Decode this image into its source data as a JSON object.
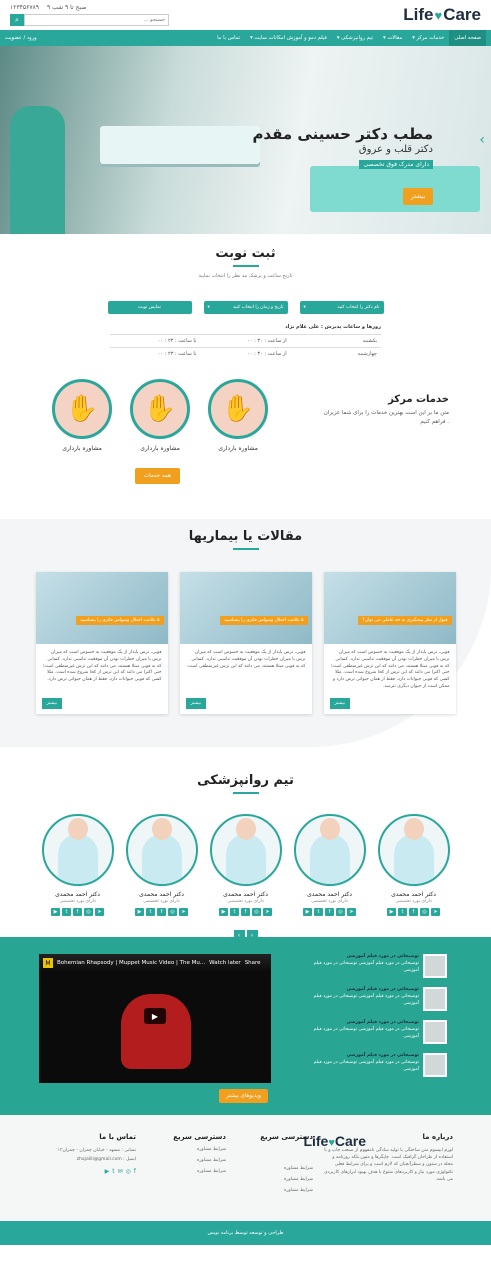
{
  "brand": {
    "logo_left": "Life",
    "logo_right": "Care",
    "logo_heart": "♥"
  },
  "topbar": {
    "phone": "۱۲۳۴۵۶۷۸۹",
    "hours": "۹ صبح تا ۹ شب",
    "search_placeholder": "جستجو ...",
    "search_icon": "search-icon"
  },
  "nav": {
    "items": [
      "صفحه اصلی",
      "خدمات مرکز ▾",
      "مقالات ▾",
      "تیم روانپزشکی ▾",
      "فیلم دمو و آموزش امکانات سایت ▾",
      "تماس با ما"
    ],
    "login": "ورود / عضویت"
  },
  "hero": {
    "title": "مطب دکتر حسینی مقدم",
    "subtitle": "دکتر قلب و عروق",
    "tag": "دارای مدرک فوق تخصصی",
    "button": "بیشتر",
    "arrow": "‹"
  },
  "booking": {
    "title": "ثبت نوبت",
    "desc": "تاریخ ساعت و پزشک مد نظر را انتخاب نمایید",
    "select_doctor": "نام دکتر را انتخاب کنید",
    "select_time": "تاریخ و زمان را انتخاب کنید",
    "show": "نمایش نوبت",
    "schedule_label": "روزها و ساعات پذیرش : علی غلام نژاد",
    "rows": [
      [
        "یکشنبه",
        "از ساعت : ۳۰ : ۰۰",
        "تا ساعت : ۲۳ : ۰۰"
      ],
      [
        "چهارشنبه",
        "از ساعت : ۳۰ : ۰۰",
        "تا ساعت : ۲۳ : ۰۰"
      ]
    ]
  },
  "services": {
    "title": "خدمات مرکز",
    "desc": "متن ما بر این است بهترین خدمات را برای شما عزیزان فراهم کنیم .",
    "items": [
      "مشاوره بارداری",
      "مشاوره بارداری",
      "مشاوره بارداری"
    ],
    "all": "همه خدمات"
  },
  "articles": {
    "title": "مقالات یا بیماریها",
    "cards": [
      {
        "ribbon": "قبول از نظر پیشگیری به جه عاملی می توان؟",
        "text": "فوبی، ترس پایدار از یک موقعیت به خصوص است که میزان ترس با میزان خطرات بودن آن موقعیت تناسبی ندارد. کسانی که به فوبی مبتلا هستند، می دانند که این ترس غیرمنطقی است؛ حتی اکثرا می دانند که این ترس از کجا شروع شده است. مثلا کسی که فوبی حیوانات دارد، فقط از همان حیوانی ترس دارد و ممکن است از حیوان دیگری نترسد.",
        "btn": "بیشتر"
      },
      {
        "ribbon": "۵ علامت اختلال وسواس فکری را بشناسید",
        "text": "فوبی، ترس پایدار از یک موقعیت به خصوص است که میزان ترس با میزان خطرات بودن آن موقعیت تناسبی ندارد. کسانی که به فوبی مبتلا هستند، می دانند که این ترس غیرمنطقی است.",
        "btn": "بیشتر"
      },
      {
        "ribbon": "۵ علامت اختلال وسواس فکری را بشناسید",
        "text": "فوبی، ترس پایدار از یک موقعیت به خصوص است که میزان ترس با میزان خطرات بودن آن موقعیت تناسبی ندارد. کسانی که به فوبی مبتلا هستند، می دانند که این ترس غیرمنطقی است؛ حتی اکثرا می دانند که این ترس از کجا شروع شده است. مثلا کسی که فوبی حیوانات دارد، فقط از همان حیوانی ترس دارد.",
        "btn": "بیشتر"
      }
    ]
  },
  "team": {
    "title": "تیم روانپزشکی",
    "doctors": [
      {
        "name": "دکتر احمد محمدی",
        "role": "دارای بورد تخصصی"
      },
      {
        "name": "دکتر احمد محمدی",
        "role": "دارای بورد تخصصی"
      },
      {
        "name": "دکتر احمد محمدی",
        "role": "دارای بورد تخصصی"
      },
      {
        "name": "دکتر احمد محمدی",
        "role": "دارای بورد تخصصی"
      },
      {
        "name": "دکتر احمد محمدی",
        "role": "دارای بورد تخصصی"
      }
    ],
    "prev": "‹",
    "next": "›"
  },
  "video": {
    "title": "Bohemian Rhapsody | Muppet Music Video | The Mu...",
    "watch_later": "Watch later",
    "share": "Share",
    "all": "ویدیوهای بیشتر",
    "items": [
      {
        "t": "توضیحاتی در مورد فیلم آموزشی",
        "d": "توضیحاتی در مورد فیلم آموزشی توضیحاتی در مورد فیلم آموزشی"
      },
      {
        "t": "توضیحاتی در مورد فیلم آموزشی",
        "d": "توضیحاتی در مورد فیلم آموزشی توضیحاتی در مورد فیلم آموزشی"
      },
      {
        "t": "توضیحاتی در مورد فیلم آموزشی",
        "d": "توضیحاتی در مورد فیلم آموزشی توضیحاتی در مورد فیلم آموزشی"
      },
      {
        "t": "توضیحاتی در مورد فیلم آموزشی",
        "d": "توضیحاتی در مورد فیلم آموزشی توضیحاتی در مورد فیلم آموزشی"
      }
    ]
  },
  "footer": {
    "about_title": "درباره ما",
    "about_text": "لورم ایپسوم متن ساختگی با تولید سادگی نامفهوم از صنعت چاپ و با استفاده از طراحان گرافیک است. چاپگرها و متون بلکه روزنامه و مجله در ستون و سطرآنچنان که لازم است و برای شرایط فعلی تکنولوژی مورد نیاز و کاربردهای متنوع با هدف بهبود ابزارهای کاربردی می باشد.",
    "quick_title": "دسترسی سریع",
    "quick": [
      "شرایط مشاوره",
      "شرایط مشاوره",
      "شرایط مشاوره"
    ],
    "quick2_title": "دسترسی سریع",
    "quick2": [
      "شرایط مشاوره",
      "شرایط مشاوره",
      "شرایط مشاوره"
    ],
    "contact_title": "تماس با ما",
    "address": "نشانی : مشهد - خیابان چمران - چمران۱۳",
    "email": "ایمیل : zhajalili@gmail.com",
    "copyright": "طراحی و توسعه توسط برنامه نویس"
  }
}
